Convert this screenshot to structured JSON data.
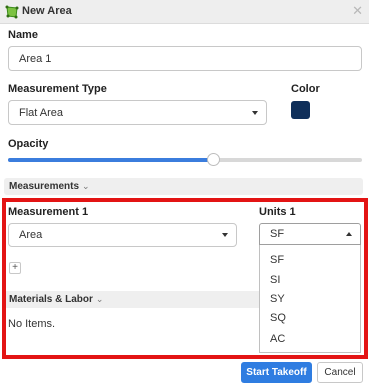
{
  "window": {
    "title": "New Area",
    "close_glyph": "✕"
  },
  "form": {
    "name_label": "Name",
    "name_value": "Area 1",
    "measurement_type_label": "Measurement Type",
    "measurement_type_value": "Flat Area",
    "color_label": "Color",
    "color_value": "#0f2f5a",
    "opacity_label": "Opacity",
    "opacity_fraction": 0.58
  },
  "measurements": {
    "header": "Measurements",
    "measurement_label": "Measurement 1",
    "measurement_value": "Area",
    "units_label": "Units 1",
    "units_value": "SF",
    "units_options": [
      "SF",
      "SI",
      "SY",
      "SQ",
      "AC"
    ],
    "add_glyph": "+"
  },
  "materials": {
    "header": "Materials & Labor",
    "empty_text": "No Items."
  },
  "actions": {
    "primary": "Start Takeoff",
    "secondary": "Cancel"
  },
  "icons": {
    "title": "area-polygon-icon",
    "close": "close-icon",
    "chevron": "chevron-down-icon"
  },
  "colors": {
    "accent": "#2f7de1",
    "highlight_frame": "#e31414"
  }
}
